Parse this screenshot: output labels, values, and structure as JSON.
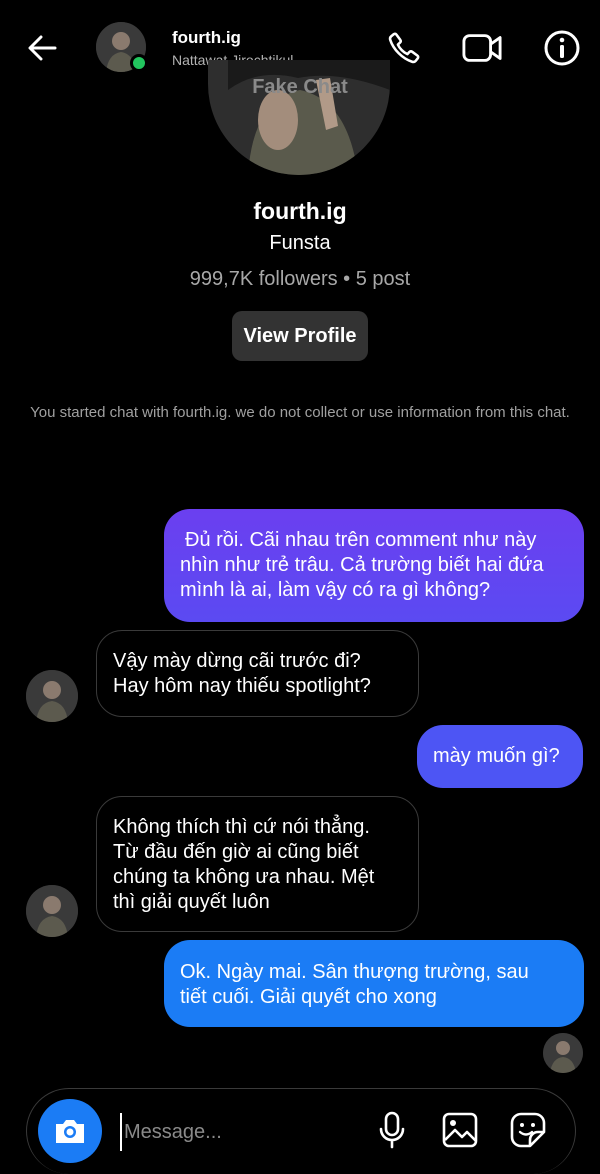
{
  "header": {
    "name": "fourth.ig",
    "subtitle": "Nattawat Jirochtikul",
    "watermark": "Fake Chat",
    "icons": [
      "back-arrow-icon",
      "phone-icon",
      "video-icon",
      "info-icon"
    ]
  },
  "profile": {
    "name": "fourth.ig",
    "tagline": "Funsta",
    "stats": "999,7K followers • 5 post",
    "view_profile_label": "View Profile"
  },
  "notice": "You started chat with fourth.ig. we do not collect or use information from this chat.",
  "messages": [
    {
      "side": "out",
      "lines": [
        "Đủ rồi. Cãi nhau trên comment như này",
        "nhìn như trẻ trâu. Cả trường biết hai đứa",
        "mình là ai, làm vậy có ra gì không?"
      ]
    },
    {
      "side": "in",
      "lines": [
        "Vậy mày dừng cãi trước đi?",
        "Hay hôm nay thiếu spotlight?"
      ]
    },
    {
      "side": "out",
      "lines": [
        "mày muốn gì?"
      ]
    },
    {
      "side": "in",
      "lines": [
        "Không thích thì cứ nói thẳng.",
        "Từ đầu đến giờ ai cũng biết",
        "chúng ta không ưa nhau. Mệt",
        "thì giải quyết luôn"
      ]
    },
    {
      "side": "out",
      "lines": [
        "Ok. Ngày mai. Sân thượng trường, sau",
        "tiết cuối. Giải quyết cho xong"
      ]
    }
  ],
  "composer": {
    "placeholder": "Message...",
    "icons": [
      "camera-icon",
      "microphone-icon",
      "gallery-icon",
      "sticker-icon"
    ]
  },
  "colors": {
    "background": "#000000",
    "bubble_out_top": "#6b3ff0",
    "bubble_out_bottom": "#1b7cf5",
    "online": "#22c55e",
    "camera_button": "#1b7cf5"
  }
}
